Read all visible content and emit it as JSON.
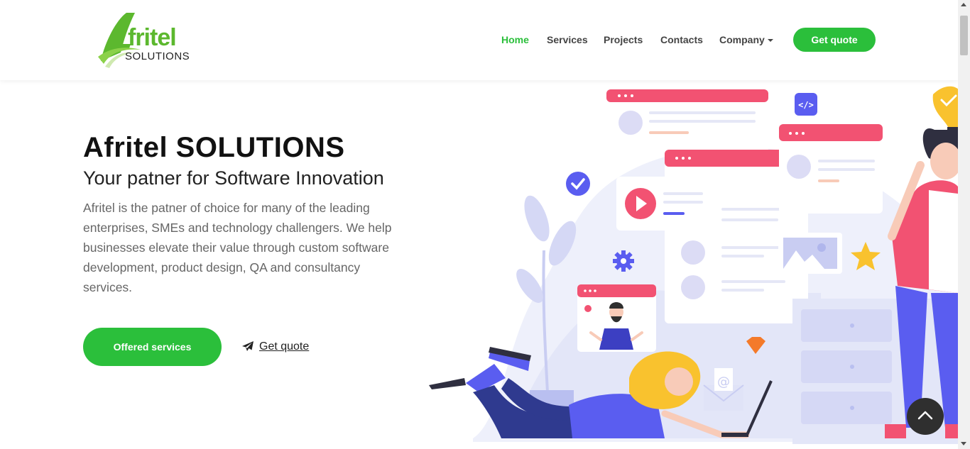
{
  "brand": {
    "logo_word": "fritel",
    "logo_letter": "A",
    "logo_sub": "SOLUTIONS",
    "accent_color": "#2bbf3b"
  },
  "nav": {
    "items": [
      {
        "label": "Home",
        "active": true
      },
      {
        "label": "Services",
        "active": false
      },
      {
        "label": "Projects",
        "active": false
      },
      {
        "label": "Contacts",
        "active": false
      },
      {
        "label": "Company",
        "active": false,
        "dropdown": true
      }
    ],
    "cta_label": "Get quote"
  },
  "hero": {
    "title": "Afritel SOLUTIONS",
    "subtitle": "Your patner for Software Innovation",
    "description": "Afritel is the patner of choice for many of the leading enterprises, SMEs and technology challengers. We help businesses elevate their value through custom software development, product design, QA and consultancy services.",
    "primary_button": "Offered services",
    "secondary_link": "Get quote"
  },
  "icons": {
    "send": "paper-plane-icon",
    "back_to_top": "chevron-up-icon"
  }
}
